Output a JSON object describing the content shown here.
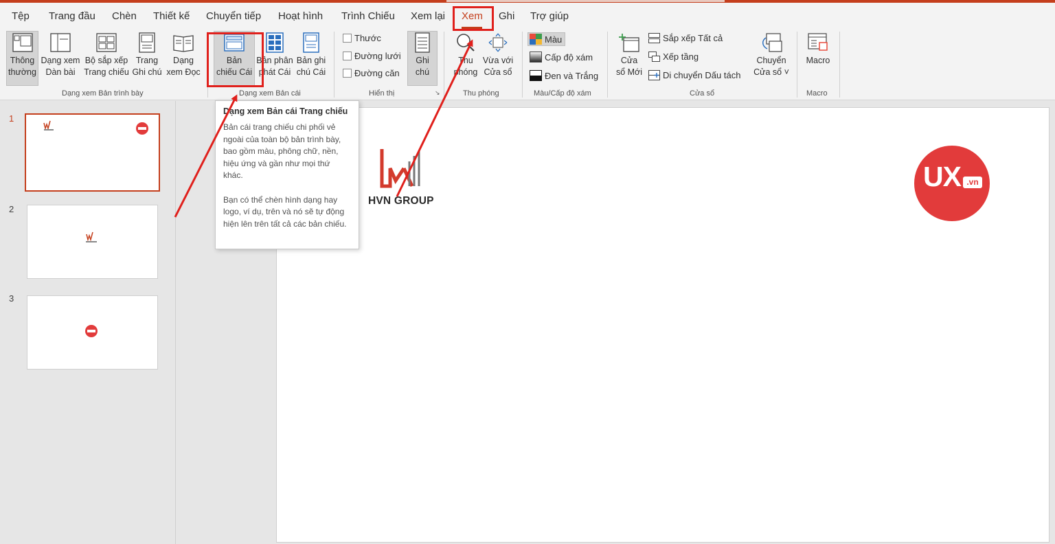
{
  "menu_tabs": [
    "Tệp",
    "Trang đầu",
    "Chèn",
    "Thiết kế",
    "Chuyển tiếp",
    "Hoạt hình",
    "Trình Chiếu",
    "Xem lại",
    "Xem",
    "Ghi",
    "Trợ giúp"
  ],
  "ribbon": {
    "presentation_views": {
      "group_label": "Dạng xem Bản trình bày",
      "normal": [
        "Thông",
        "thường"
      ],
      "outline": [
        "Dạng xem",
        "Dàn bài"
      ],
      "sorter": [
        "Bộ sắp xếp",
        "Trang chiếu"
      ],
      "notes_page": [
        "Trang",
        "Ghi chú"
      ],
      "reading": [
        "Dạng",
        "xem Đọc"
      ]
    },
    "master_views": {
      "group_label": "Dạng xem Bản cái",
      "slide_master": [
        "Bản",
        "chiếu Cái"
      ],
      "handout_master": [
        "Bản phân",
        "phát Cái"
      ],
      "notes_master": [
        "Bản ghi",
        "chú Cái"
      ]
    },
    "show": {
      "group_label": "Hiển thị",
      "ruler": "Thước",
      "gridlines": "Đường lưới",
      "guides": "Đường căn",
      "notes": [
        "Ghi",
        "chú"
      ]
    },
    "zoom": {
      "group_label": "Thu phóng",
      "zoom": [
        "Thu",
        "phóng"
      ],
      "fit": [
        "Vừa với",
        "Cửa sổ"
      ]
    },
    "color": {
      "group_label": "Màu/Cấp độ xám",
      "color": "Màu",
      "grayscale": "Cấp độ xám",
      "bw": "Đen và Trắng"
    },
    "window": {
      "group_label": "Cửa sổ",
      "new_window": [
        "Cửa",
        "sổ Mới"
      ],
      "arrange_all": "Sắp xếp Tất cả",
      "cascade": "Xếp tầng",
      "move_split": "Di chuyển Dấu tách",
      "switch": [
        "Chuyển",
        "Cửa sổ ˅"
      ]
    },
    "macro": {
      "group_label": "Macro",
      "macro": "Macro"
    }
  },
  "thumbnails": [
    {
      "number": "1",
      "selected": true
    },
    {
      "number": "2",
      "selected": false
    },
    {
      "number": "3",
      "selected": false
    }
  ],
  "slide": {
    "logo_text": "HVN GROUP",
    "ux_main": "UX",
    "ux_suffix": ".vn"
  },
  "tooltip": {
    "title": "Dạng xem Bản cái Trang chiếu",
    "para1": "Bản cái trang chiếu chi phối vẻ ngoài của toàn bộ bản trình bày, bao gồm màu, phông chữ, nền, hiệu ứng và gần như mọi thứ khác.",
    "para2": "Bạn có thể chèn hình dạng hay logo, ví dụ, trên  và nó sẽ tự động hiện lên trên tất cả các bản chiếu."
  },
  "colors": {
    "accent": "#c43e1c",
    "annotation_red": "#e0201c",
    "ux_red": "#e23b3b"
  }
}
